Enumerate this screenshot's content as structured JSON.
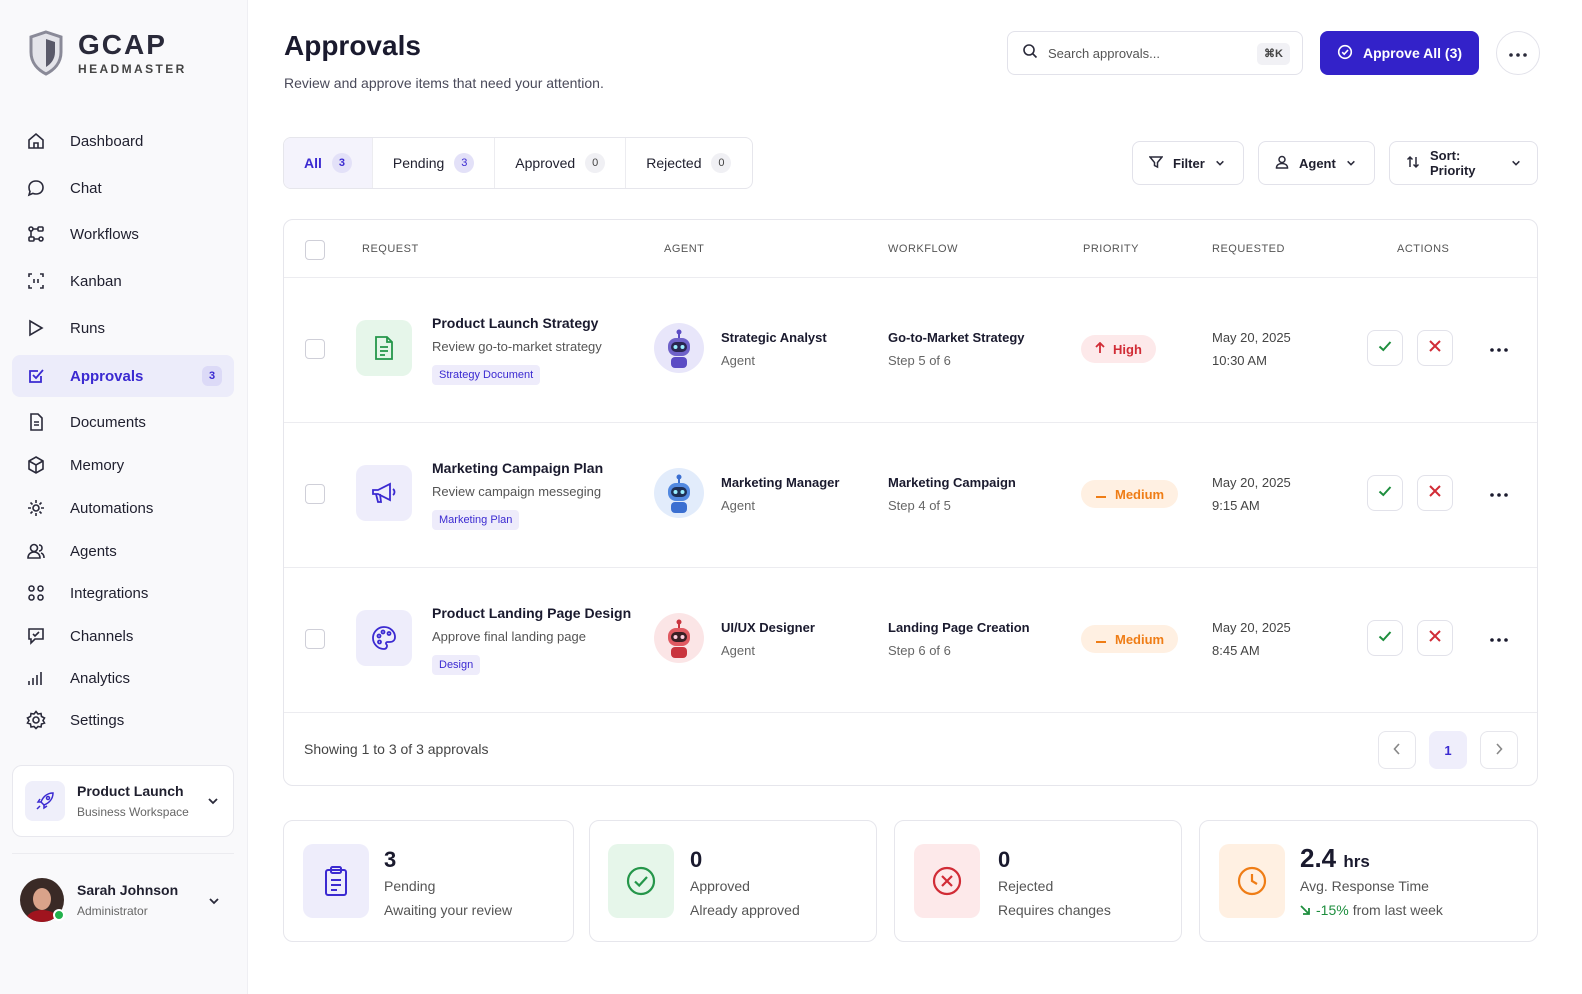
{
  "brand": {
    "title": "GCAP",
    "subtitle": "HEADMASTER"
  },
  "sidebar": {
    "items": [
      {
        "label": "Dashboard",
        "icon": "home-icon"
      },
      {
        "label": "Chat",
        "icon": "chat-icon"
      },
      {
        "label": "Workflows",
        "icon": "workflow-icon"
      },
      {
        "label": "Kanban",
        "icon": "kanban-icon"
      },
      {
        "label": "Runs",
        "icon": "play-icon"
      },
      {
        "label": "Approvals",
        "icon": "checkbox-icon",
        "badge": "3",
        "active": true
      },
      {
        "label": "Documents",
        "icon": "document-icon"
      },
      {
        "label": "Memory",
        "icon": "cube-icon"
      },
      {
        "label": "Automations",
        "icon": "automation-icon"
      },
      {
        "label": "Agents",
        "icon": "users-icon"
      },
      {
        "label": "Integrations",
        "icon": "grid-icon"
      },
      {
        "label": "Channels",
        "icon": "channel-icon"
      },
      {
        "label": "Analytics",
        "icon": "analytics-icon"
      },
      {
        "label": "Settings",
        "icon": "gear-icon"
      }
    ],
    "workspace": {
      "title": "Product Launch",
      "subtitle": "Business Workspace"
    },
    "user": {
      "name": "Sarah Johnson",
      "role": "Administrator"
    }
  },
  "header": {
    "title": "Approvals",
    "subtitle": "Review and approve items that need your attention.",
    "search_placeholder": "Search approvals...",
    "search_shortcut": "⌘K",
    "approve_all_label": "Approve All (3)"
  },
  "tabs": [
    {
      "label": "All",
      "count": "3"
    },
    {
      "label": "Pending",
      "count": "3"
    },
    {
      "label": "Approved",
      "count": "0"
    },
    {
      "label": "Rejected",
      "count": "0"
    }
  ],
  "controls": {
    "filter": "Filter",
    "agent": "Agent",
    "sort": "Sort: Priority"
  },
  "table": {
    "columns": [
      "REQUEST",
      "AGENT",
      "WORKFLOW",
      "PRIORITY",
      "REQUESTED",
      "ACTIONS"
    ],
    "rows": [
      {
        "title": "Product Launch Strategy",
        "subtitle": "Review go-to-market strategy",
        "tag": "Strategy Document",
        "icon": "document-icon",
        "agent": "Strategic Analyst",
        "agent_role": "Agent",
        "workflow": "Go-to-Market Strategy",
        "step": "Step 5 of 6",
        "priority": "High",
        "date": "May 20, 2025",
        "time": "10:30 AM"
      },
      {
        "title": "Marketing Campaign Plan",
        "subtitle": "Review campaign messeging",
        "tag": "Marketing Plan",
        "icon": "megaphone-icon",
        "agent": "Marketing Manager",
        "agent_role": "Agent",
        "workflow": "Marketing Campaign",
        "step": "Step 4 of 5",
        "priority": "Medium",
        "date": "May 20, 2025",
        "time": "9:15 AM"
      },
      {
        "title": "Product Landing Page Design",
        "subtitle": "Approve final landing page",
        "tag": "Design",
        "icon": "palette-icon",
        "agent": "UI/UX Designer",
        "agent_role": "Agent",
        "workflow": "Landing Page Creation",
        "step": "Step 6 of 6",
        "priority": "Medium",
        "date": "May 20, 2025",
        "time": "8:45 AM"
      }
    ],
    "footer": "Showing 1 to 3 of 3 approvals",
    "current_page": "1"
  },
  "stats": [
    {
      "value": "3",
      "label": "Pending",
      "sub": "Awaiting your review",
      "icon": "clipboard-icon"
    },
    {
      "value": "0",
      "label": "Approved",
      "sub": "Already approved",
      "icon": "check-circle-icon"
    },
    {
      "value": "0",
      "label": "Rejected",
      "sub": "Requires changes",
      "icon": "x-circle-icon"
    },
    {
      "value": "2.4",
      "unit": "hrs",
      "label": "Avg. Response Time",
      "trend": "-15%",
      "trend_text": "from last week",
      "icon": "clock-icon"
    }
  ],
  "colors": {
    "accent": "#3322c9",
    "high": "#d12c36",
    "medium": "#ef7d16",
    "success": "#1e8e3e"
  }
}
